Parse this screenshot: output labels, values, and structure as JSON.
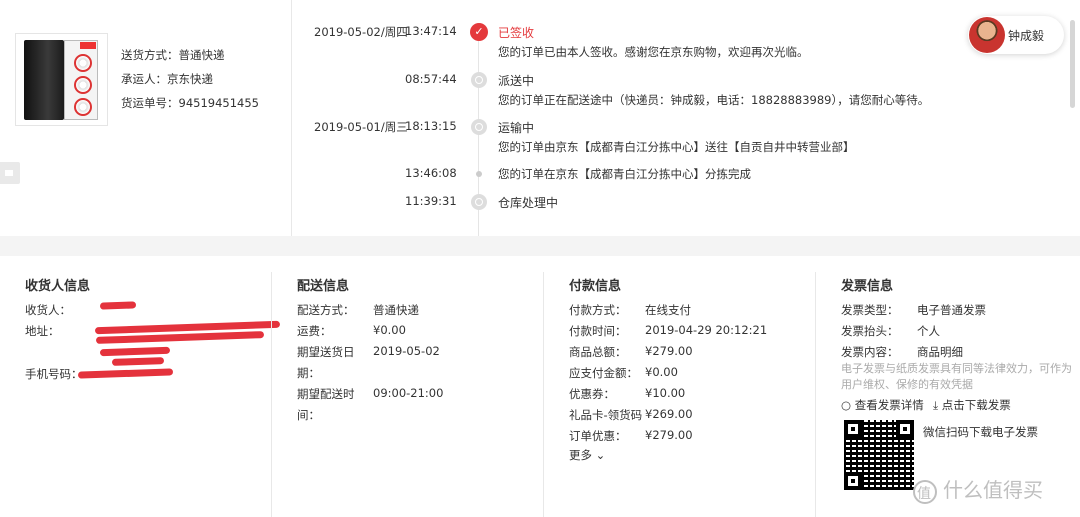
{
  "shipping": {
    "method_label": "送货方式：",
    "method": "普通快递",
    "carrier_label": "承运人：",
    "carrier": "京东快递",
    "tracking_label": "货运单号：",
    "tracking": "94519451455"
  },
  "courier": {
    "name": "钟成毅"
  },
  "timeline": [
    {
      "date": "2019-05-02/周四",
      "time": "13:47:14",
      "title": "已签收",
      "desc": "您的订单已由本人签收。感谢您在京东购物，欢迎再次光临。"
    },
    {
      "date": "",
      "time": "08:57:44",
      "title": "派送中",
      "desc": "您的订单正在配送途中（快递员：钟成毅，电话：18828883989），请您耐心等待。"
    },
    {
      "date": "2019-05-01/周三",
      "time": "18:13:15",
      "title": "运输中",
      "desc": "您的订单由京东【成都青白江分拣中心】送往【自贡自井中转营业部】"
    },
    {
      "date": "",
      "time": "13:46:08",
      "title": "",
      "desc": "您的订单在京东【成都青白江分拣中心】分拣完成"
    },
    {
      "date": "",
      "time": "11:39:31",
      "title": "仓库处理中",
      "desc": ""
    }
  ],
  "receiver": {
    "title": "收货人信息",
    "name_label": "收货人：",
    "address_label": "地址：",
    "phone_label": "手机号码："
  },
  "delivery": {
    "title": "配送信息",
    "method_label": "配送方式：",
    "method": "普通快递",
    "fee_label": "运费：",
    "fee": "¥0.00",
    "date_label_1": "期望送货日",
    "date_label_2": "期：",
    "date": "2019-05-02",
    "time_label_1": "期望配送时",
    "time_label_2": "间：",
    "time": "09:00-21:00"
  },
  "payment": {
    "title": "付款信息",
    "rows": [
      {
        "label": "付款方式：",
        "value": "在线支付"
      },
      {
        "label": "付款时间：",
        "value": "2019-04-29 20:12:21"
      },
      {
        "label": "商品总额：",
        "value": "¥279.00"
      },
      {
        "label": "应支付金额：",
        "value": "¥0.00"
      },
      {
        "label": "优惠券：",
        "value": "¥10.00"
      },
      {
        "label": "礼品卡-领货码",
        "value": "¥269.00"
      },
      {
        "label": "订单优惠：",
        "value": "¥279.00"
      }
    ],
    "more": "更多 ⌄"
  },
  "invoice": {
    "title": "发票信息",
    "type_label": "发票类型：",
    "type": "电子普通发票",
    "header_label": "发票抬头：",
    "header": "个人",
    "content_label": "发票内容：",
    "content": "商品明细",
    "note": "电子发票与纸质发票具有同等法律效力，可作为用户维权、保修的有效凭据",
    "view_label": "查看发票详情",
    "download_label": "点击下载发票",
    "qr_text": "微信扫码下载电子发票"
  },
  "watermark": "什么值得买"
}
